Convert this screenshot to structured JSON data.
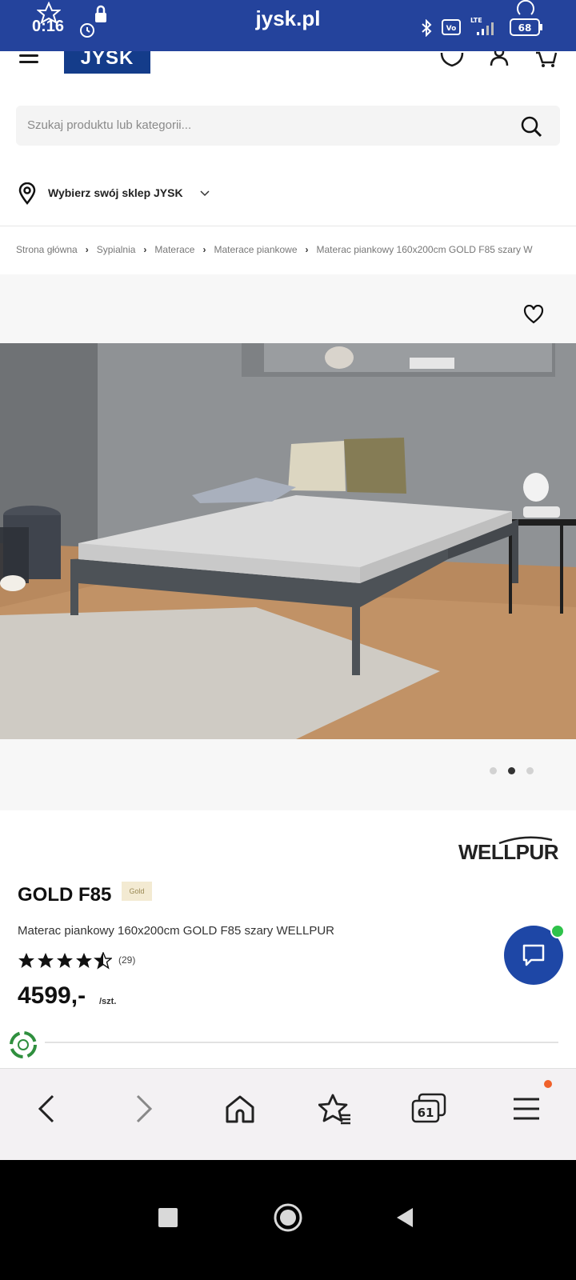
{
  "status_bar": {
    "time": "0:16",
    "url": "jysk.pl",
    "battery": "68",
    "network": "LTE",
    "icons": [
      "star-icon",
      "lock-icon",
      "alarm-icon",
      "bluetooth-icon",
      "volte-icon",
      "signal-icon",
      "reload-icon",
      "battery-icon"
    ]
  },
  "header": {
    "logo": "JYSK",
    "icons": [
      "menu-icon",
      "heart-icon",
      "user-icon",
      "cart-icon"
    ]
  },
  "search": {
    "placeholder": "Szukaj produktu lub kategorii..."
  },
  "store": {
    "label": "Wybierz swój sklep JYSK"
  },
  "breadcrumb": [
    "Strona główna",
    "Sypialnia",
    "Materace",
    "Materace piankowe",
    "Materac piankowy 160x200cm GOLD F85 szary W"
  ],
  "gallery": {
    "image_count": 3,
    "active_index": 1
  },
  "product": {
    "brand": "WELLPUR",
    "name": "GOLD F85",
    "badge": "Gold",
    "description": "Materac piankowy 160x200cm GOLD F85 szary WELLPUR",
    "rating": 4.5,
    "reviews": "(29)",
    "price": "4599,-",
    "unit": "/szt."
  },
  "browser_bar": {
    "tabs_count": "61",
    "icons": [
      "back-icon",
      "forward-icon",
      "home-icon",
      "bookmarks-icon",
      "tabs-icon",
      "menu-icon"
    ]
  },
  "colors": {
    "status_bar": "#24439c",
    "brand_blue": "#143c8a",
    "chat_blue": "#1e47a6",
    "online_green": "#2fc24a",
    "notification_orange": "#f0612a"
  }
}
